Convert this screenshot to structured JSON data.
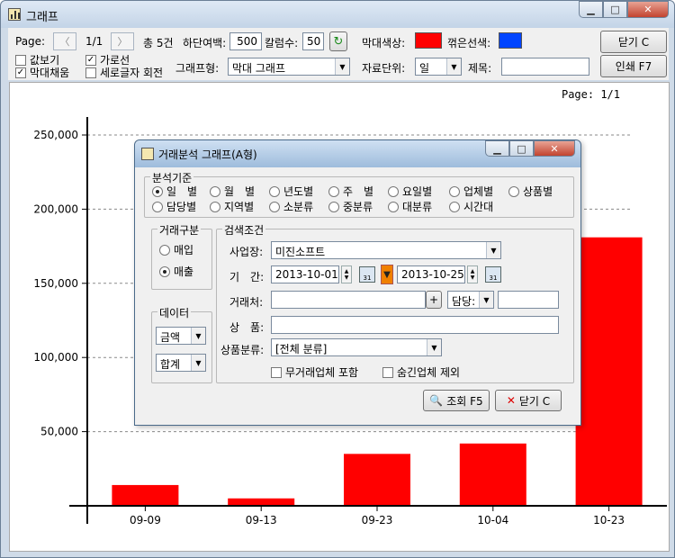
{
  "window": {
    "title": "그래프"
  },
  "toolbar": {
    "page_label": "Page:",
    "page_value": "1/1",
    "total_text": "총 5건",
    "bottom_margin_label": "하단여백:",
    "bottom_margin_value": "500",
    "column_count_label": "칼럼수:",
    "column_count_value": "50",
    "bar_color_label": "막대색상:",
    "bar_color": "#ff0000",
    "line_color_label": "꺾은선색:",
    "line_color": "#0044ff",
    "close_label": "닫기 C",
    "print_label": "인쇄 F7",
    "show_values_label": "값보기",
    "bar_fill_label": "막대채움",
    "gridline_label": "가로선",
    "rotate_label": "세로글자 회전",
    "chart_type_label": "그래프형:",
    "chart_type_value": "막대 그래프",
    "data_unit_label": "자료단위:",
    "data_unit_value": "일",
    "title_label": "제목:",
    "title_value": ""
  },
  "chart_header": {
    "page": "Page: 1/1"
  },
  "chart_data": {
    "type": "bar",
    "categories": [
      "09-09",
      "09-13",
      "09-23",
      "10-04",
      "10-23"
    ],
    "values": [
      14000,
      5000,
      35000,
      42000,
      181000
    ],
    "ylim": [
      0,
      250000
    ],
    "yticks": [
      50000,
      100000,
      150000,
      200000,
      250000
    ],
    "ytick_labels": [
      "50,000",
      "100,000",
      "150,000",
      "200,000",
      "250,000"
    ],
    "bar_color": "#ff0000",
    "grid": true
  },
  "dialog": {
    "title": "거래분석 그래프(A형)",
    "basis_group": "분석기준",
    "basis_options": [
      "일　별",
      "월　별",
      "년도별",
      "주　별",
      "요일별",
      "업체별",
      "상품별",
      "담당별",
      "지역별",
      "소분류",
      "중분류",
      "대분류",
      "시간대"
    ],
    "trade_group": "거래구분",
    "trade_options": [
      "매입",
      "매출"
    ],
    "data_group": "데이터",
    "data_select1": "금액",
    "data_select2": "합계",
    "search_group": "검색조건",
    "business_label": "사업장:",
    "business_value": "미진소프트",
    "period_label": "기　간:",
    "date_from": "2013-10-01",
    "date_to": "2013-10-25",
    "calendar_text": "31",
    "client_label": "거래처:",
    "client_value": "",
    "plus_text": "+",
    "manager_label": "담당:",
    "manager_value": "",
    "product_label": "상　품:",
    "product_value": "",
    "category_label": "상품분류:",
    "category_value": "[전체 분류]",
    "no_trade_label": "무거래업체 포함",
    "hidden_label": "숨긴업체 제외",
    "search_button": "조회 F5",
    "close_button": "닫기 C"
  }
}
